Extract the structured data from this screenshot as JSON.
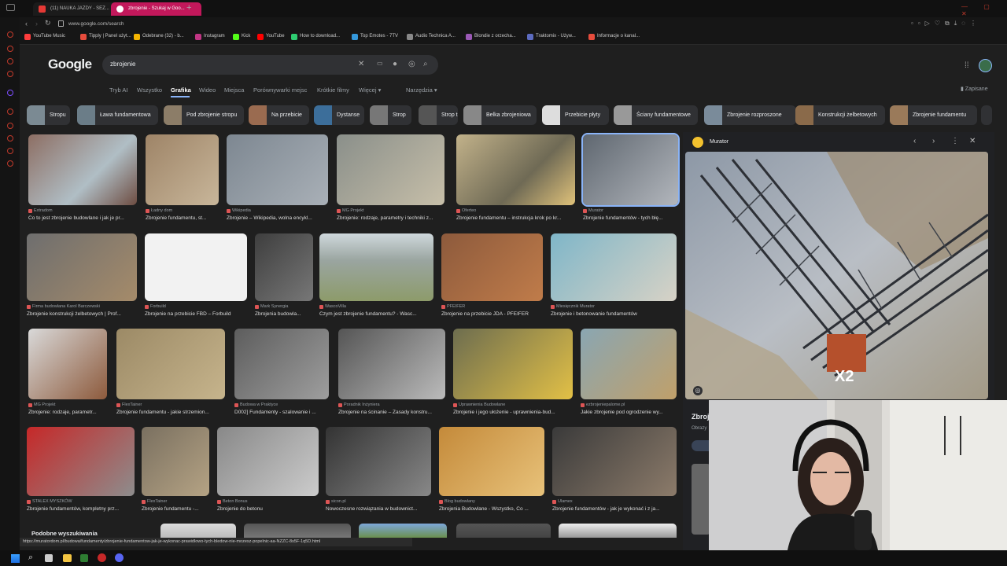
{
  "browser": {
    "tabs": [
      {
        "label": "(11) NAUKA JAZDY - SEZ...",
        "active": false
      },
      {
        "label": "zbrojenie - Szukaj w Goo...",
        "active": true
      }
    ],
    "new_tab": "+",
    "url": "www.google.com/search",
    "bookmarks": [
      "YouTube Music",
      "Tipply | Panel użyt...",
      "Odebrane (32) - b...",
      "Instagram",
      "Kick",
      "YouTube",
      "How to download...",
      "Top Emotes - 7TV",
      "Audio Technica A...",
      "Blondie z orzecha...",
      "Traktomix - Używ...",
      "Informacje o kanal..."
    ]
  },
  "google": {
    "logo": "Google",
    "query": "zbrojenie",
    "nav": [
      "Tryb AI",
      "Wszystko",
      "Grafika",
      "Wideo",
      "Miejsca",
      "Porównywarki mejsc",
      "Krótkie filmy",
      "Więcej ▾",
      "Narzędzia ▾"
    ],
    "active_nav": "Grafika",
    "saved": "Zapisane",
    "chips": [
      "Stropu",
      "Ława fundamentowa",
      "Pod zbrojenie stropu",
      "Na przebicie",
      "Dystanse",
      "Strop",
      "Strop teriva",
      "Belka zbrojeniowa",
      "Przebicie płyty",
      "Ściany fundamentowe",
      "Zbrojenie rozproszone",
      "Konstrukcji żelbetowych",
      "Zbrojenie fundamentu"
    ]
  },
  "results": [
    {
      "source": "Extradom",
      "title": "Co to jest zbrojenie budowlane i jak je pr..."
    },
    {
      "source": "Ładny dom",
      "title": "Zbrojenie fundamentu, st..."
    },
    {
      "source": "Wikipedia",
      "title": "Zbrojenie – Wikipedia, wolna encykl..."
    },
    {
      "source": "MG Projekt",
      "title": "Zbrojenie: rodzaje, parametry i techniki z..."
    },
    {
      "source": "Oferteo",
      "title": "Zbrojenie fundamentu – instrukcja krok po kr..."
    },
    {
      "source": "Murator",
      "title": "Zbrojenie fundamentów - tych błę..."
    },
    {
      "source": "Firma budowlana Karol Barczewski",
      "title": "Zbrojenie konstrukcji żelbetowych | Prof..."
    },
    {
      "source": "Forbuild",
      "title": "Zbrojenie na przebicie FBD – Forbuild"
    },
    {
      "source": "Mark Synergia",
      "title": "Zbrojenia budowla..."
    },
    {
      "source": "WascoVilla",
      "title": "Czym jest zbrojenie fundamentu? - Wasc..."
    },
    {
      "source": "PFEIFER",
      "title": "Zbrojenie na przebicie JDA - PFEIFER"
    },
    {
      "source": "Miesięcznik Murator",
      "title": "Zbrojenie i betonowanie fundamentów"
    },
    {
      "source": "MG Projekt",
      "title": "Zbrojenie: rodzaje, parametr..."
    },
    {
      "source": "FlexTainer",
      "title": "Zbrojenie fundamentu - jakie strzemion..."
    },
    {
      "source": "Budowa w Praktyce",
      "title": "D002] Fundamenty - szalowanie i ..."
    },
    {
      "source": "Poradnik Inżyniera",
      "title": "Zbrojenie na ścinanie – Zasady konstru..."
    },
    {
      "source": "Uprawnienia Budowlane",
      "title": "Zbrojenie i jego ułożenie - uprawnienia-bud..."
    },
    {
      "source": "ezbrojeniepalome.pl",
      "title": "Jakie zbrojenie pod ogrodzenie wy..."
    },
    {
      "source": "STALEX MYSZKÓW",
      "title": "Zbrojenie fundamentów, kompletny prz..."
    },
    {
      "source": "FlexTainer",
      "title": "Zbrojenie fundamentu -..."
    },
    {
      "source": "Beton Bonus",
      "title": "Zbrojenie do betonu"
    },
    {
      "source": "sicon.pl",
      "title": "Nowoczesne rozwiązania w budownict..."
    },
    {
      "source": "Blog budowlany",
      "title": "Zbrojenia Budowlane - Wszystko, Co ..."
    },
    {
      "source": "Ulamex",
      "title": "Zbrojenie fundamentów - jak je wykonać i z ja..."
    }
  ],
  "related_heading": "Podobne wyszukiwania",
  "panel": {
    "source": "Murator",
    "title_partial": "Zbroj",
    "subtitle_partial": "Obrazy"
  },
  "status_url": "https://muratordom.pl/budowa/fundamenty/zbrojenie-fundamentow-jak-je-wykonac-prawidlowo-tych-bledow-nie-mozesz-popelnic-aa-NZZC-8s5F-1q5D.html",
  "overlay_badge": "X2",
  "colors": {
    "accent": "#8ab4f8",
    "bg": "#1f1f1f",
    "surface": "#303134"
  }
}
